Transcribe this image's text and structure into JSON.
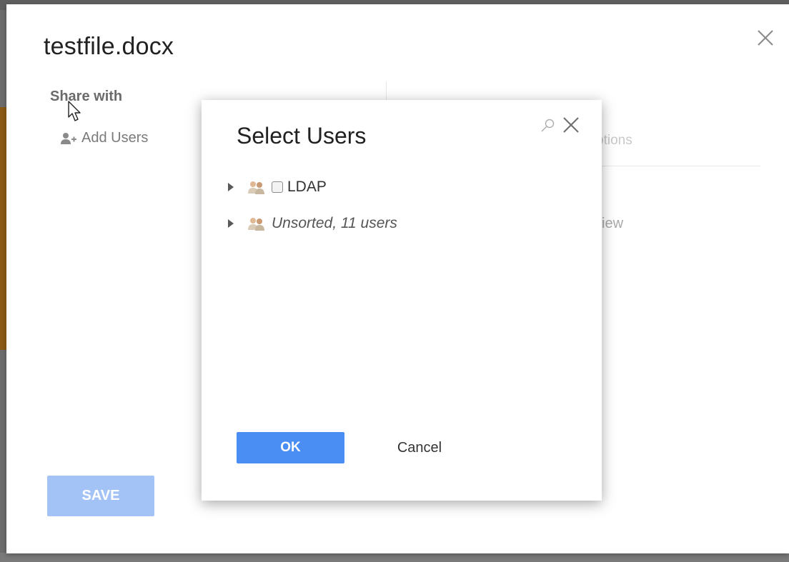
{
  "share_dialog": {
    "title": "testfile.docx",
    "close_icon": "close-icon",
    "share_with_label": "Share with",
    "add_users_icon": "add-user-icon",
    "add_users_label": "Add Users",
    "options_tab_fragment": "ptions",
    "view_fragment": "iew",
    "save_label": "SAVE",
    "save_enabled": false
  },
  "select_users_dialog": {
    "title": "Select Users",
    "search_icon": "search-icon",
    "close_icon": "close-icon",
    "tree": [
      {
        "label": "LDAP",
        "icon": "user-group-icon",
        "checkbox": true,
        "checked": false,
        "italic": false
      },
      {
        "label": "Unsorted, 11 users",
        "icon": "user-group-icon",
        "checkbox": false,
        "italic": true
      }
    ],
    "ok_label": "OK",
    "cancel_label": "Cancel"
  },
  "colors": {
    "primary": "#4a8df3",
    "primary_disabled": "#a3c3f7",
    "overlay": "#6d6d6d"
  }
}
